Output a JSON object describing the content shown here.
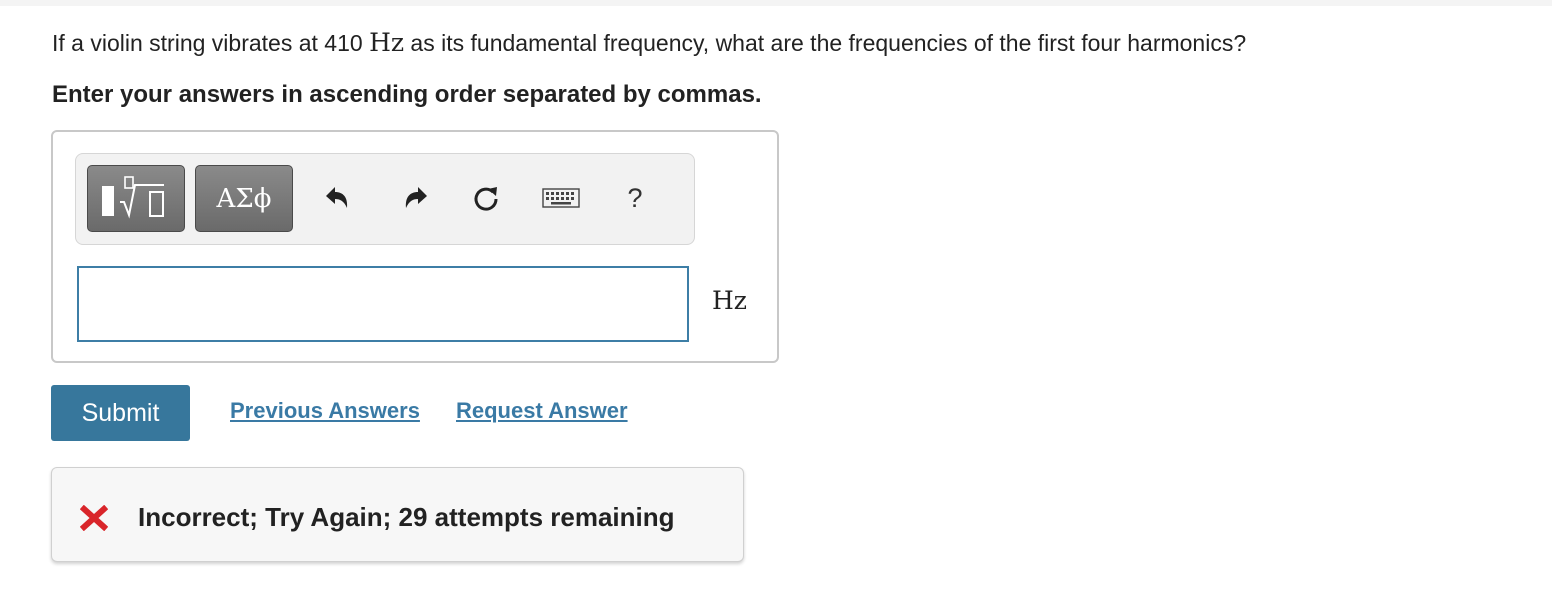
{
  "question": {
    "text_before": "If a violin string vibrates at 410 ",
    "unit": "Hz",
    "text_after": " as its fundamental frequency, what are the frequencies of the first four harmonics?"
  },
  "instruction": "Enter your answers in ascending order separated by commas.",
  "toolbar": {
    "templates_icon": "templates-icon",
    "symbols_label": "ΑΣϕ",
    "icons": [
      "undo-icon",
      "redo-icon",
      "reset-icon",
      "keyboard-icon"
    ],
    "help_label": "?"
  },
  "answer": {
    "value": "",
    "unit": "Hz"
  },
  "actions": {
    "submit_label": "Submit",
    "previous_answers_label": "Previous Answers",
    "request_answer_label": "Request Answer"
  },
  "feedback": {
    "icon": "x-mark-icon",
    "text": "Incorrect; Try Again; 29 attempts remaining",
    "icon_color": "#d9252a"
  },
  "colors": {
    "accent": "#37779c",
    "link": "#3a7aa5",
    "input_border": "#3d7ea6"
  }
}
